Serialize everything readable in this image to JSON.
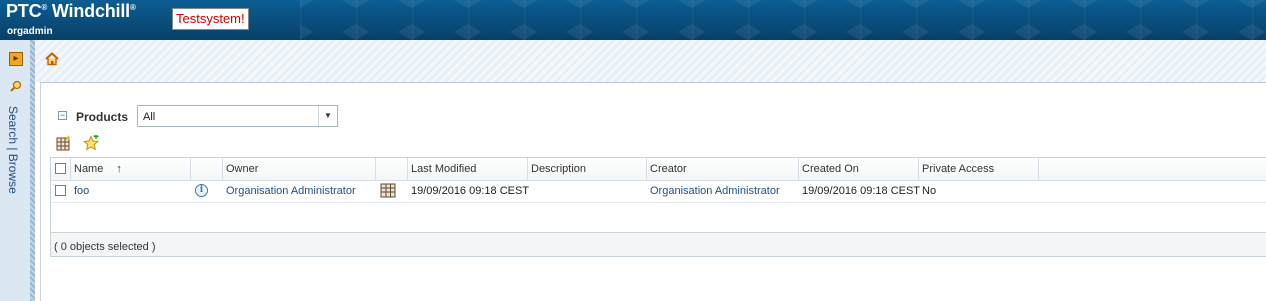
{
  "app": {
    "brand": "PTC",
    "brand_reg": "®",
    "brand_name": "Windchill",
    "brand_tm": "®",
    "user": "orgadmin",
    "environment_badge": "Testsystem!"
  },
  "left_nav": {
    "tabs": [
      {
        "label": "Search | Browse"
      }
    ],
    "icons": [
      "nav-toggle-icon",
      "search-icon"
    ]
  },
  "products": {
    "title": "Products",
    "filter": {
      "selected": "All"
    },
    "toolbar_icons": [
      "new-product-icon",
      "favorite-star-icon"
    ],
    "table": {
      "columns": [
        "Name",
        "",
        "Owner",
        "",
        "Last Modified",
        "Description",
        "Creator",
        "Created On",
        "Private Access"
      ],
      "sort_indicator": "↑",
      "rows": [
        {
          "name": "foo",
          "owner": "Organisation Administrator",
          "last_modified": "19/09/2016 09:18 CEST",
          "description": "",
          "creator": "Organisation Administrator",
          "created_on": "19/09/2016 09:18 CEST",
          "private_access": "No"
        }
      ],
      "footer": "( 0 objects selected )"
    }
  },
  "colors": {
    "header_blue": "#0a4d7c",
    "badge_red": "#d30000",
    "link_blue": "#1e4f8c"
  }
}
